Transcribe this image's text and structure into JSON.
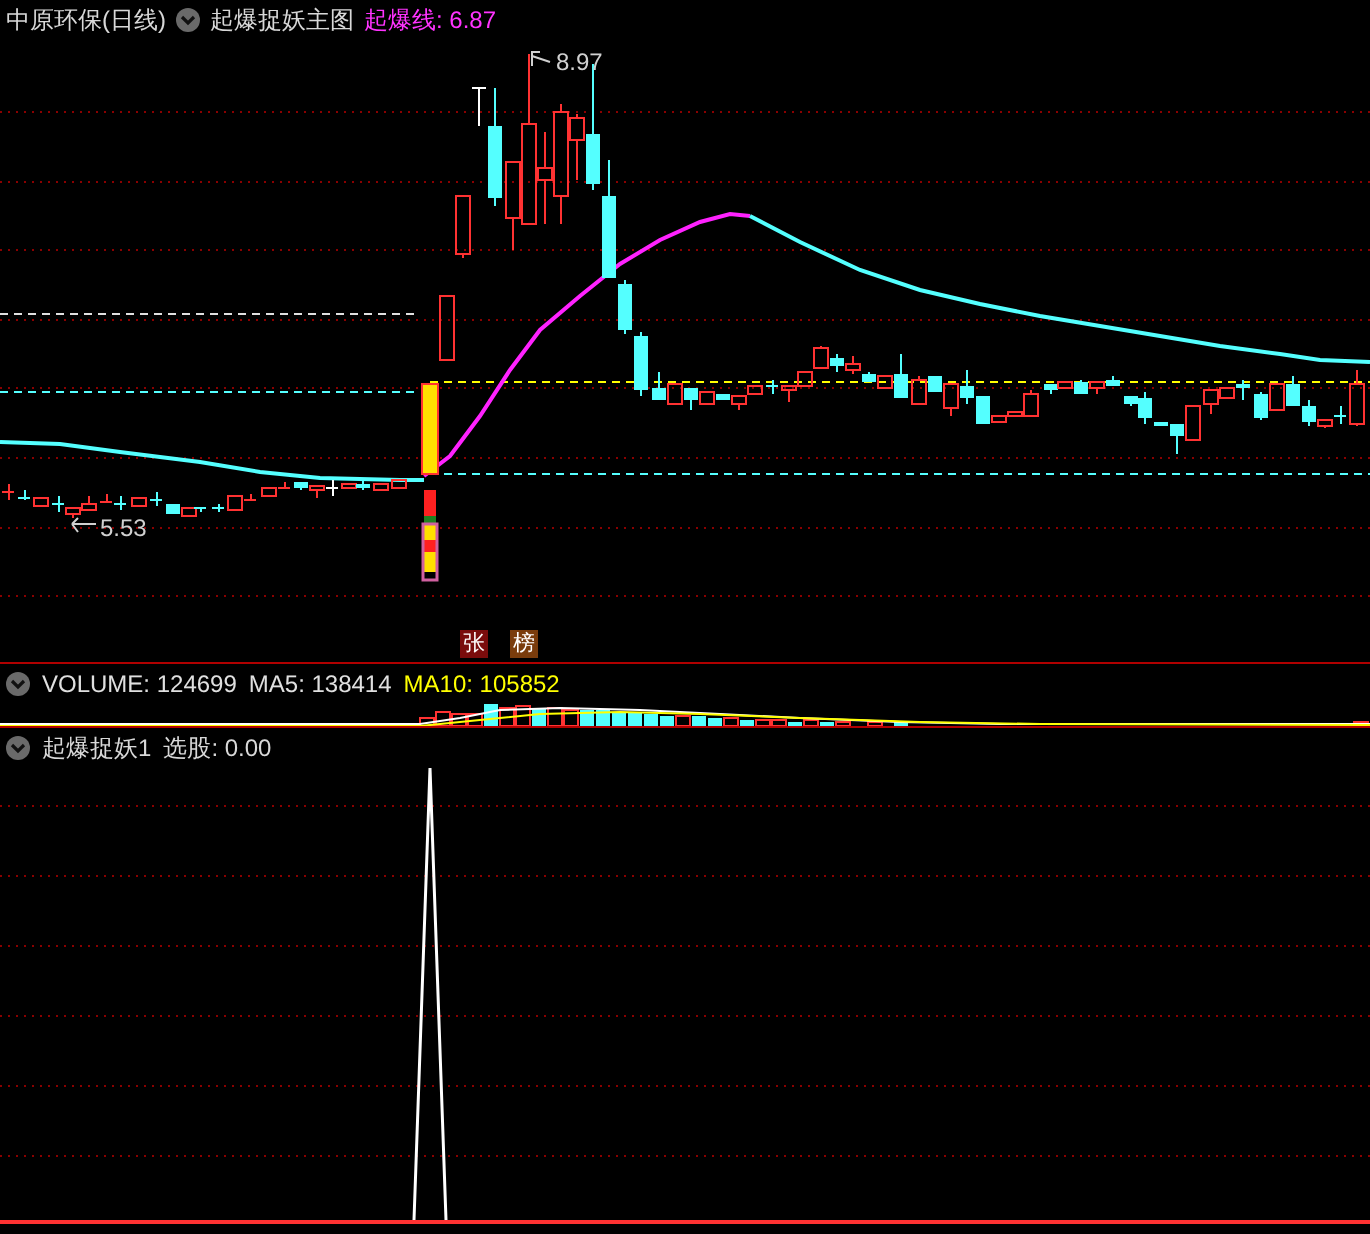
{
  "header": {
    "title": "中原环保(日线)",
    "indicator": "起爆捉妖主图",
    "value_label": "起爆线: 6.87"
  },
  "main_chart": {
    "high_label": "8.97",
    "low_label": "5.53",
    "badges": [
      {
        "text": "张",
        "color": "#7a0c0c"
      },
      {
        "text": "榜",
        "color": "#7a3c0c"
      }
    ]
  },
  "volume": {
    "stats": [
      {
        "text": "VOLUME: 124699",
        "color": "#e0e0e0"
      },
      {
        "text": "MA5: 138414",
        "color": "#e0e0e0"
      },
      {
        "text": "MA10: 105852",
        "color": "#ffff00"
      }
    ]
  },
  "indicator_pane": {
    "name": "起爆捉妖1",
    "reading": "选股: 0.00"
  }
}
